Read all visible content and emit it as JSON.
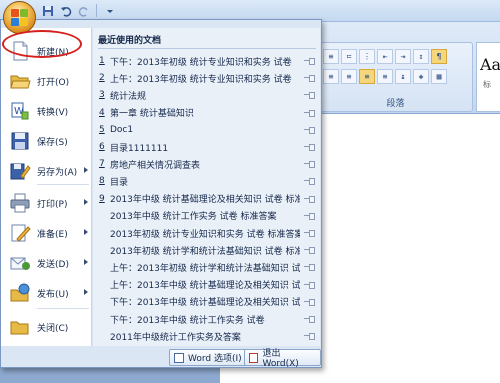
{
  "quick_access": {
    "save_icon": "save-icon",
    "undo_icon": "undo-icon",
    "redo_icon": "redo-icon",
    "customize_icon": "customize-qat-icon"
  },
  "ribbon": {
    "paragraph_group_label": "段落",
    "styles_sample": "Aa",
    "styles_sub": "标"
  },
  "office_menu": {
    "items": [
      {
        "label": "新建(N)",
        "icon": "new-document-icon",
        "has_submenu": false
      },
      {
        "label": "打开(O)",
        "icon": "open-folder-icon",
        "has_submenu": false
      },
      {
        "label": "转换(V)",
        "icon": "convert-icon",
        "has_submenu": false
      },
      {
        "label": "保存(S)",
        "icon": "save-disk-icon",
        "has_submenu": false
      },
      {
        "label": "另存为(A)",
        "icon": "save-as-icon",
        "has_submenu": true
      },
      {
        "label": "打印(P)",
        "icon": "printer-icon",
        "has_submenu": true
      },
      {
        "label": "准备(E)",
        "icon": "prepare-icon",
        "has_submenu": true
      },
      {
        "label": "发送(D)",
        "icon": "send-icon",
        "has_submenu": true
      },
      {
        "label": "发布(U)",
        "icon": "publish-icon",
        "has_submenu": true
      },
      {
        "label": "关闭(C)",
        "icon": "close-folder-icon",
        "has_submenu": false
      }
    ],
    "recent_title": "最近使用的文档",
    "recent_documents": [
      {
        "num": "1",
        "name": "下午：2013年初级 统计专业知识和实务 试卷"
      },
      {
        "num": "2",
        "name": "上午：2013年初级 统计专业知识和实务 试卷"
      },
      {
        "num": "3",
        "name": "统计法规"
      },
      {
        "num": "4",
        "name": "第一章 统计基础知识"
      },
      {
        "num": "5",
        "name": "Doc1"
      },
      {
        "num": "6",
        "name": "目录1111111"
      },
      {
        "num": "7",
        "name": "房地产相关情况调查表"
      },
      {
        "num": "8",
        "name": "目录"
      },
      {
        "num": "9",
        "name": "2013年中级 统计基础理论及相关知识 试卷 标准..."
      },
      {
        "num": "",
        "name": "2013年中级 统计工作实务 试卷 标准答案"
      },
      {
        "num": "",
        "name": "2013年初级 统计专业知识和实务 试卷 标准答案"
      },
      {
        "num": "",
        "name": "2013年初级 统计学和统计法基础知识 试卷 标准..."
      },
      {
        "num": "",
        "name": "上午：2013年初级 统计学和统计法基础知识 试卷"
      },
      {
        "num": "",
        "name": "上午：2013年中级 统计基础理论及相关知识 试卷"
      },
      {
        "num": "",
        "name": "下午：2013年中级 统计基础理论及相关知识 试卷"
      },
      {
        "num": "",
        "name": "下午：2013年中级 统计工作实务 试卷"
      },
      {
        "num": "",
        "name": "2011年中级统计工作实务及答案"
      }
    ],
    "footer": {
      "options_label": "Word 选项(I)",
      "exit_label": "退出 Word(X)"
    }
  },
  "colors": {
    "menu_background": "#dbe6f4",
    "highlight_ellipse": "#d62020",
    "ribbon_background": "#cfdff3"
  }
}
